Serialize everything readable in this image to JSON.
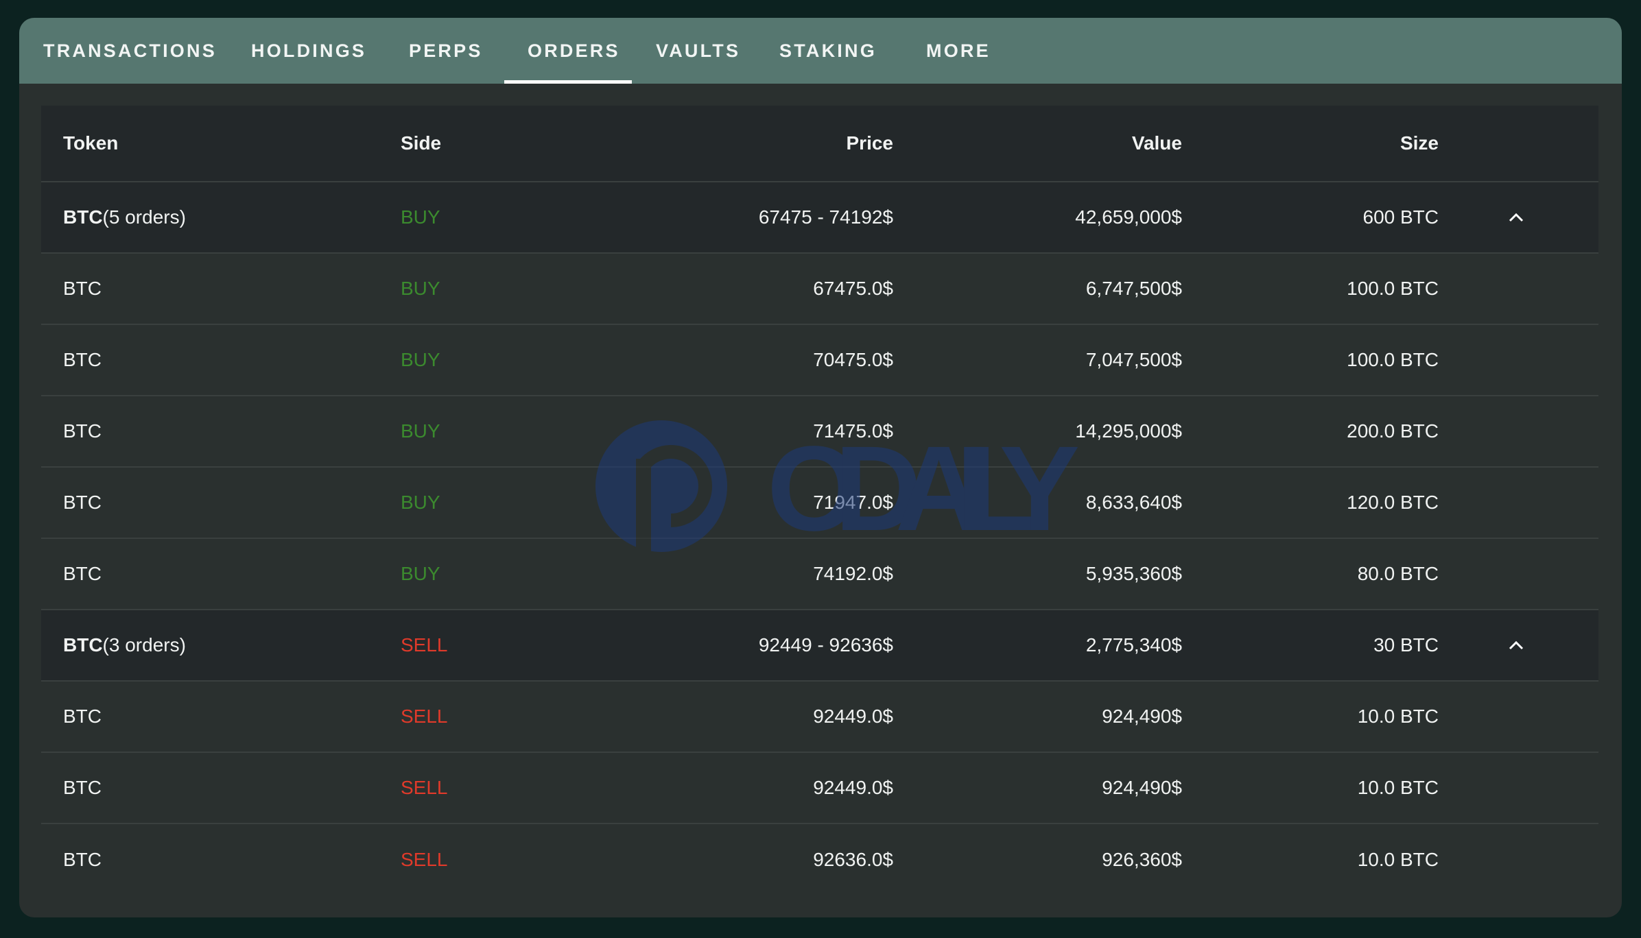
{
  "tabs": [
    {
      "label": "TRANSACTIONS",
      "active": false
    },
    {
      "label": "HOLDINGS",
      "active": false
    },
    {
      "label": "PERPS",
      "active": false
    },
    {
      "label": "ORDERS",
      "active": true
    },
    {
      "label": "VAULTS",
      "active": false
    },
    {
      "label": "STAKING",
      "active": false
    },
    {
      "label": "MORE",
      "active": false
    }
  ],
  "table": {
    "columns": {
      "token": "Token",
      "side": "Side",
      "price": "Price",
      "value": "Value",
      "size": "Size"
    },
    "groups": [
      {
        "token": "BTC",
        "count": "(5 orders)",
        "side": "BUY",
        "price": "67475 - 74192$",
        "value": "42,659,000$",
        "size": "600 BTC",
        "rows": [
          {
            "token": "BTC",
            "side": "BUY",
            "price": "67475.0$",
            "value": "6,747,500$",
            "size": "100.0 BTC"
          },
          {
            "token": "BTC",
            "side": "BUY",
            "price": "70475.0$",
            "value": "7,047,500$",
            "size": "100.0 BTC"
          },
          {
            "token": "BTC",
            "side": "BUY",
            "price": "71475.0$",
            "value": "14,295,000$",
            "size": "200.0 BTC"
          },
          {
            "token": "BTC",
            "side": "BUY",
            "price": "71947.0$",
            "value": "8,633,640$",
            "size": "120.0 BTC"
          },
          {
            "token": "BTC",
            "side": "BUY",
            "price": "74192.0$",
            "value": "5,935,360$",
            "size": "80.0 BTC"
          }
        ]
      },
      {
        "token": "BTC",
        "count": "(3 orders)",
        "side": "SELL",
        "price": "92449 - 92636$",
        "value": "2,775,340$",
        "size": "30 BTC",
        "rows": [
          {
            "token": "BTC",
            "side": "SELL",
            "price": "92449.0$",
            "value": "924,490$",
            "size": "10.0 BTC"
          },
          {
            "token": "BTC",
            "side": "SELL",
            "price": "92449.0$",
            "value": "924,490$",
            "size": "10.0 BTC"
          },
          {
            "token": "BTC",
            "side": "SELL",
            "price": "92636.0$",
            "value": "926,360$",
            "size": "10.0 BTC"
          }
        ]
      }
    ]
  },
  "watermark": {
    "text": "ODAILY",
    "color": "#1d3a78"
  },
  "colors": {
    "buy": "#3b8a2e",
    "sell": "#e03a2a",
    "tabbar": "#567770",
    "background": "#0c2220"
  },
  "icons": {
    "group_toggle": "chevron-up-icon"
  }
}
